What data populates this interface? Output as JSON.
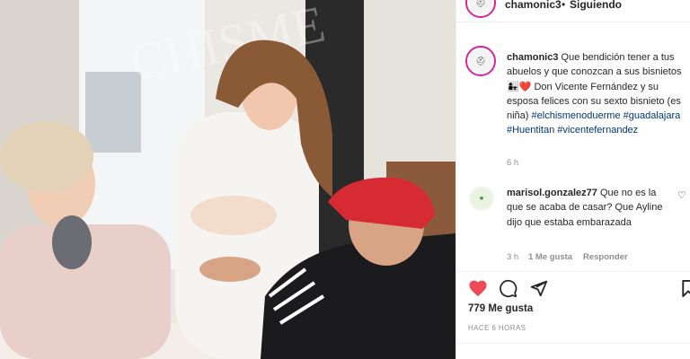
{
  "post": {
    "username": "chamonic3",
    "separator": "•",
    "follow_status": "Siguiendo",
    "caption_username": "chamonic3",
    "caption_text": "Que bendición tener a tus abuelos y que conozcan a sus bisnietos 👩‍👧❤️ Don Vicente Fernández y su esposa felices con su sexto bisnieto (es niña)",
    "hashtags": [
      "#elchismenoduerme",
      "#guadalajara",
      "#Huentitan",
      "#vicentefernandez"
    ],
    "caption_time": "6 h",
    "likes": "779 Me gusta",
    "time_ago": "HACE 6 HORAS",
    "watermark": "CHISME"
  },
  "comment": {
    "username": "marisol.gonzalez77",
    "text": "Que no es la que se acaba de casar? Que Ayline dijo que estaba embarazada",
    "time": "3 h",
    "likes": "1 Me gusta",
    "reply": "Responder"
  },
  "icons": {
    "like": "heart-icon",
    "comment": "comment-icon",
    "share": "paper-plane-icon",
    "save": "bookmark-icon",
    "comment_like": "small-heart-icon"
  },
  "colors": {
    "like_red": "#ed4956",
    "text": "#262626",
    "secondary": "#8e8e8e",
    "hashtag": "#00376b",
    "story_ring": "#d6249f"
  }
}
